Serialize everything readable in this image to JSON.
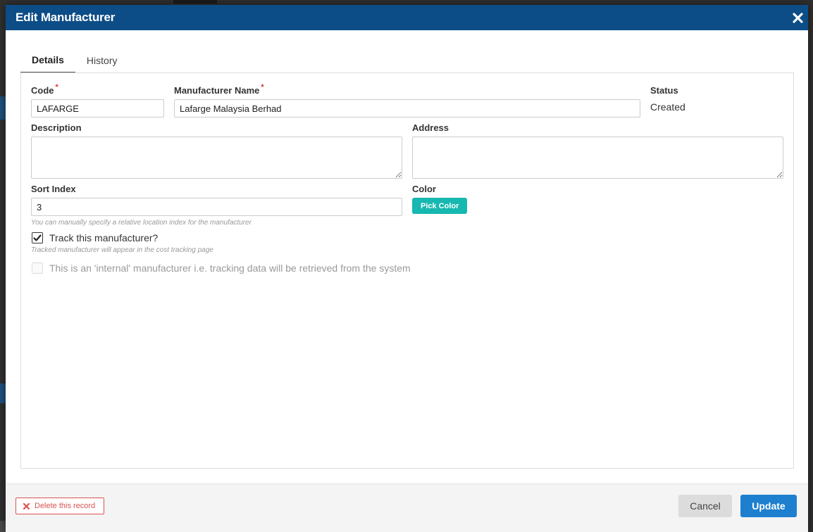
{
  "modal": {
    "title": "Edit Manufacturer",
    "close_icon": "close-icon"
  },
  "tabs": [
    {
      "label": "Details",
      "active": true
    },
    {
      "label": "History",
      "active": false
    }
  ],
  "form": {
    "code": {
      "label": "Code",
      "required_mark": "*",
      "value": "LAFARGE"
    },
    "manufacturer_name": {
      "label": "Manufacturer Name",
      "required_mark": "*",
      "value": "Lafarge Malaysia Berhad"
    },
    "status": {
      "label": "Status",
      "value": "Created"
    },
    "description": {
      "label": "Description",
      "value": ""
    },
    "address": {
      "label": "Address",
      "value": ""
    },
    "sort_index": {
      "label": "Sort Index",
      "value": "3",
      "hint": "You can manually specify a relative location index for the manufacturer"
    },
    "color": {
      "label": "Color",
      "button_label": "Pick Color",
      "button_color": "#16b8b0"
    },
    "track": {
      "label": "Track this manufacturer?",
      "checked": true,
      "hint": "Tracked manufacturer will appear in the cost tracking page"
    },
    "internal": {
      "label": "This is an 'internal' manufacturer i.e. tracking data will be retrieved from the system",
      "checked": false,
      "disabled": true
    }
  },
  "footer": {
    "delete_label": "Delete this record",
    "delete_icon": "x-icon",
    "cancel_label": "Cancel",
    "update_label": "Update"
  },
  "colors": {
    "header_bg": "#0d4d87",
    "update_bg": "#1e7fcf",
    "delete_red": "#d9534f"
  }
}
